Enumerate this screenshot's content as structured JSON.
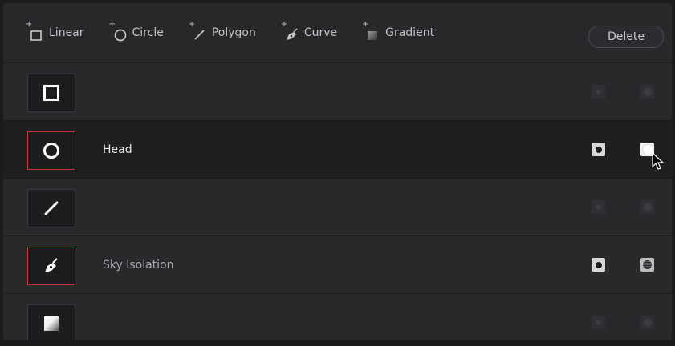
{
  "toolbar": {
    "tools": [
      {
        "label": "Linear",
        "icon": "plus-square-icon"
      },
      {
        "label": "Circle",
        "icon": "plus-circle-icon"
      },
      {
        "label": "Polygon",
        "icon": "plus-polygon-icon"
      },
      {
        "label": "Curve",
        "icon": "plus-pen-curve-icon"
      },
      {
        "label": "Gradient",
        "icon": "plus-gradient-icon"
      }
    ],
    "delete_label": "Delete"
  },
  "windows": [
    {
      "shape": "square",
      "label": "",
      "active": false,
      "selected": false,
      "enabled": false
    },
    {
      "shape": "circle",
      "label": "Head",
      "active": true,
      "selected": true,
      "enabled": true
    },
    {
      "shape": "line",
      "label": "",
      "active": false,
      "selected": false,
      "enabled": false
    },
    {
      "shape": "pen",
      "label": "Sky Isolation",
      "active": true,
      "selected": false,
      "enabled": true
    },
    {
      "shape": "gradient",
      "label": "",
      "active": false,
      "selected": false,
      "enabled": false
    }
  ],
  "colors": {
    "panel_bg": "#28282b",
    "selected_row_bg": "#1f1f22",
    "active_outline": "#c23a2c"
  }
}
